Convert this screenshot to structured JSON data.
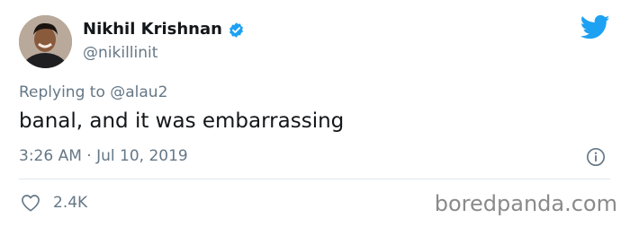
{
  "author": {
    "display_name": "Nikhil Krishnan",
    "handle": "@nikillinit",
    "verified": true,
    "avatar_icon": "avatar"
  },
  "platform_icon": "twitter-bird-icon",
  "reply": {
    "prefix": "Replying to",
    "mention": "@alau2"
  },
  "tweet": {
    "text": "banal, and it was embarrassing",
    "timestamp": "3:26 AM · Jul 10, 2019"
  },
  "engagement": {
    "likes": "2.4K"
  },
  "watermark": "boredpanda.com",
  "colors": {
    "twitter_blue": "#1da1f2",
    "text_primary": "#14171a",
    "text_secondary": "#657786",
    "divider": "#e1e8ed"
  }
}
